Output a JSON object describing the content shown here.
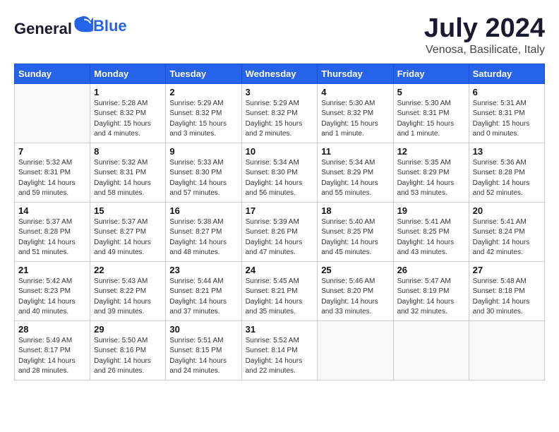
{
  "header": {
    "logo_general": "General",
    "logo_blue": "Blue",
    "month": "July 2024",
    "location": "Venosa, Basilicate, Italy"
  },
  "weekdays": [
    "Sunday",
    "Monday",
    "Tuesday",
    "Wednesday",
    "Thursday",
    "Friday",
    "Saturday"
  ],
  "weeks": [
    [
      {
        "day": "",
        "info": ""
      },
      {
        "day": "1",
        "info": "Sunrise: 5:28 AM\nSunset: 8:32 PM\nDaylight: 15 hours\nand 4 minutes."
      },
      {
        "day": "2",
        "info": "Sunrise: 5:29 AM\nSunset: 8:32 PM\nDaylight: 15 hours\nand 3 minutes."
      },
      {
        "day": "3",
        "info": "Sunrise: 5:29 AM\nSunset: 8:32 PM\nDaylight: 15 hours\nand 2 minutes."
      },
      {
        "day": "4",
        "info": "Sunrise: 5:30 AM\nSunset: 8:32 PM\nDaylight: 15 hours\nand 1 minute."
      },
      {
        "day": "5",
        "info": "Sunrise: 5:30 AM\nSunset: 8:31 PM\nDaylight: 15 hours\nand 1 minute."
      },
      {
        "day": "6",
        "info": "Sunrise: 5:31 AM\nSunset: 8:31 PM\nDaylight: 15 hours\nand 0 minutes."
      }
    ],
    [
      {
        "day": "7",
        "info": "Sunrise: 5:32 AM\nSunset: 8:31 PM\nDaylight: 14 hours\nand 59 minutes."
      },
      {
        "day": "8",
        "info": "Sunrise: 5:32 AM\nSunset: 8:31 PM\nDaylight: 14 hours\nand 58 minutes."
      },
      {
        "day": "9",
        "info": "Sunrise: 5:33 AM\nSunset: 8:30 PM\nDaylight: 14 hours\nand 57 minutes."
      },
      {
        "day": "10",
        "info": "Sunrise: 5:34 AM\nSunset: 8:30 PM\nDaylight: 14 hours\nand 56 minutes."
      },
      {
        "day": "11",
        "info": "Sunrise: 5:34 AM\nSunset: 8:29 PM\nDaylight: 14 hours\nand 55 minutes."
      },
      {
        "day": "12",
        "info": "Sunrise: 5:35 AM\nSunset: 8:29 PM\nDaylight: 14 hours\nand 53 minutes."
      },
      {
        "day": "13",
        "info": "Sunrise: 5:36 AM\nSunset: 8:28 PM\nDaylight: 14 hours\nand 52 minutes."
      }
    ],
    [
      {
        "day": "14",
        "info": "Sunrise: 5:37 AM\nSunset: 8:28 PM\nDaylight: 14 hours\nand 51 minutes."
      },
      {
        "day": "15",
        "info": "Sunrise: 5:37 AM\nSunset: 8:27 PM\nDaylight: 14 hours\nand 49 minutes."
      },
      {
        "day": "16",
        "info": "Sunrise: 5:38 AM\nSunset: 8:27 PM\nDaylight: 14 hours\nand 48 minutes."
      },
      {
        "day": "17",
        "info": "Sunrise: 5:39 AM\nSunset: 8:26 PM\nDaylight: 14 hours\nand 47 minutes."
      },
      {
        "day": "18",
        "info": "Sunrise: 5:40 AM\nSunset: 8:25 PM\nDaylight: 14 hours\nand 45 minutes."
      },
      {
        "day": "19",
        "info": "Sunrise: 5:41 AM\nSunset: 8:25 PM\nDaylight: 14 hours\nand 43 minutes."
      },
      {
        "day": "20",
        "info": "Sunrise: 5:41 AM\nSunset: 8:24 PM\nDaylight: 14 hours\nand 42 minutes."
      }
    ],
    [
      {
        "day": "21",
        "info": "Sunrise: 5:42 AM\nSunset: 8:23 PM\nDaylight: 14 hours\nand 40 minutes."
      },
      {
        "day": "22",
        "info": "Sunrise: 5:43 AM\nSunset: 8:22 PM\nDaylight: 14 hours\nand 39 minutes."
      },
      {
        "day": "23",
        "info": "Sunrise: 5:44 AM\nSunset: 8:21 PM\nDaylight: 14 hours\nand 37 minutes."
      },
      {
        "day": "24",
        "info": "Sunrise: 5:45 AM\nSunset: 8:21 PM\nDaylight: 14 hours\nand 35 minutes."
      },
      {
        "day": "25",
        "info": "Sunrise: 5:46 AM\nSunset: 8:20 PM\nDaylight: 14 hours\nand 33 minutes."
      },
      {
        "day": "26",
        "info": "Sunrise: 5:47 AM\nSunset: 8:19 PM\nDaylight: 14 hours\nand 32 minutes."
      },
      {
        "day": "27",
        "info": "Sunrise: 5:48 AM\nSunset: 8:18 PM\nDaylight: 14 hours\nand 30 minutes."
      }
    ],
    [
      {
        "day": "28",
        "info": "Sunrise: 5:49 AM\nSunset: 8:17 PM\nDaylight: 14 hours\nand 28 minutes."
      },
      {
        "day": "29",
        "info": "Sunrise: 5:50 AM\nSunset: 8:16 PM\nDaylight: 14 hours\nand 26 minutes."
      },
      {
        "day": "30",
        "info": "Sunrise: 5:51 AM\nSunset: 8:15 PM\nDaylight: 14 hours\nand 24 minutes."
      },
      {
        "day": "31",
        "info": "Sunrise: 5:52 AM\nSunset: 8:14 PM\nDaylight: 14 hours\nand 22 minutes."
      },
      {
        "day": "",
        "info": ""
      },
      {
        "day": "",
        "info": ""
      },
      {
        "day": "",
        "info": ""
      }
    ]
  ]
}
